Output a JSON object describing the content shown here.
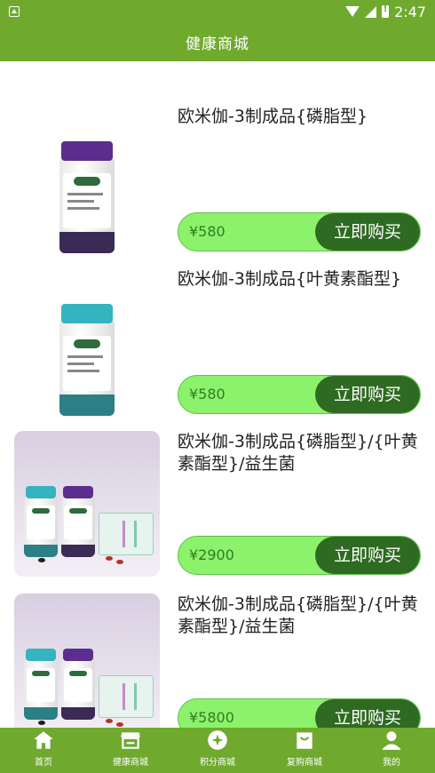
{
  "status_bar": {
    "time": "2:47"
  },
  "header": {
    "title": "健康商城"
  },
  "products": [
    {
      "name": "欧米伽-3制成品{磷脂型}",
      "price": "¥580",
      "buy_label": "立即购买"
    },
    {
      "name": "欧米伽-3制成品{叶黄素酯型}",
      "price": "¥580",
      "buy_label": "立即购买"
    },
    {
      "name": "欧米伽-3制成品{磷脂型}/{叶黄素酯型}/益生菌",
      "price": "¥2900",
      "buy_label": "立即购买"
    },
    {
      "name": "欧米伽-3制成品{磷脂型}/{叶黄素酯型}/益生菌",
      "price": "¥5800",
      "buy_label": "立即购买"
    }
  ],
  "tabs": [
    {
      "label": "首页",
      "icon": "home-icon"
    },
    {
      "label": "健康商城",
      "icon": "store-icon"
    },
    {
      "label": "积分商城",
      "icon": "points-icon"
    },
    {
      "label": "复购商城",
      "icon": "shopping-bag-icon"
    },
    {
      "label": "我的",
      "icon": "user-icon"
    }
  ],
  "colors": {
    "brand_green": "#6faa2e",
    "price_bar": "#8df26b",
    "buy_button": "#2f6a22"
  }
}
